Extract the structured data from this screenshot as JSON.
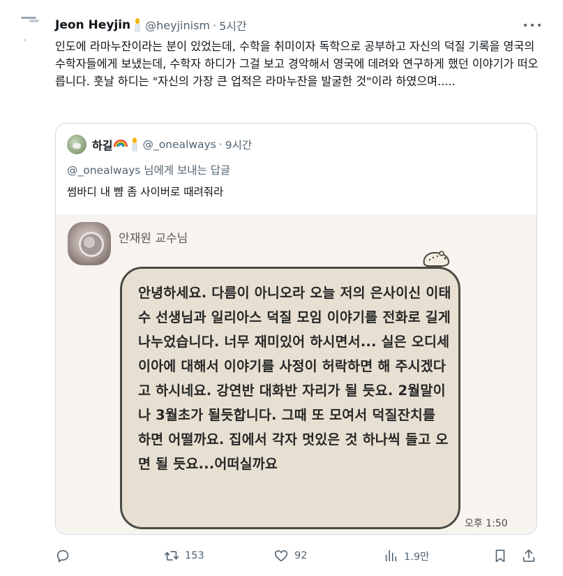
{
  "tweet": {
    "author": {
      "display_name": "Jeon Heyjin",
      "handle": "@heyjinism",
      "time": "5시간",
      "separator": "·",
      "badge_icon": "candle-emoji"
    },
    "text": "인도에 라마누잔이라는 분이 있었는데, 수학을 취미이자 독학으로 공부하고 자신의 덕질 기록을 영국의 수학자들에게 보냈는데, 수학자 하디가 그걸 보고 경악해서 영국에 데려와 연구하게 했던 이야기가 떠오릅니다. 훗날 하디는 \"자신의 가장 큰 업적은 라마누잔을 발굴한 것\"이라 하였으며.....",
    "more_icon": "more-horizontal-icon"
  },
  "quote": {
    "author": {
      "display_name": "하길",
      "emoji": [
        "rainbow-emoji",
        "candle-emoji"
      ],
      "handle": "@_onealways",
      "time": "9시간",
      "separator": "·"
    },
    "reply_to": "@_onealways 님에게 보내는 답글",
    "text": "썸바디 내 뺨 좀 사이버로 때려줘라",
    "chat": {
      "sender_name": "안재원 교수님",
      "message": "안녕하세요.  다름이 아니오라  오늘 저의 은사이신 이태수 선생님과 일리아스 덕질 모임 이야기를 전화로 길게 나누었습니다. 너무 재미있어 하시면서... 실은 오디세이아에 대해서 이야기를 사정이 허락하면 해 주시겠다고 하시네요.  강연반 대화반  자리가 될 듯요. 2월말이나 3월초가 될듯합니다.  그때 또 모여서 덕질잔치를 하면 어떨까요. 집에서 각자 멋있은 것 하나씩 들고 오면 될 듯요...어떠실까요",
      "time": "오후 1:50",
      "colors": {
        "background": "#f7f3ee",
        "bubble": "#e7e0d2",
        "bubble_border": "#4a4a44"
      }
    }
  },
  "actions": {
    "reply": {
      "icon": "reply-icon",
      "count": ""
    },
    "retweet": {
      "icon": "retweet-icon",
      "count": "153"
    },
    "like": {
      "icon": "heart-icon",
      "count": "92"
    },
    "views": {
      "icon": "views-chart-icon",
      "count": "1.9만"
    },
    "bookmark": {
      "icon": "bookmark-icon",
      "count": ""
    },
    "share": {
      "icon": "share-icon",
      "count": ""
    }
  },
  "colors": {
    "text": "#0f1419",
    "secondary": "#536471",
    "border": "#cfd9de"
  }
}
